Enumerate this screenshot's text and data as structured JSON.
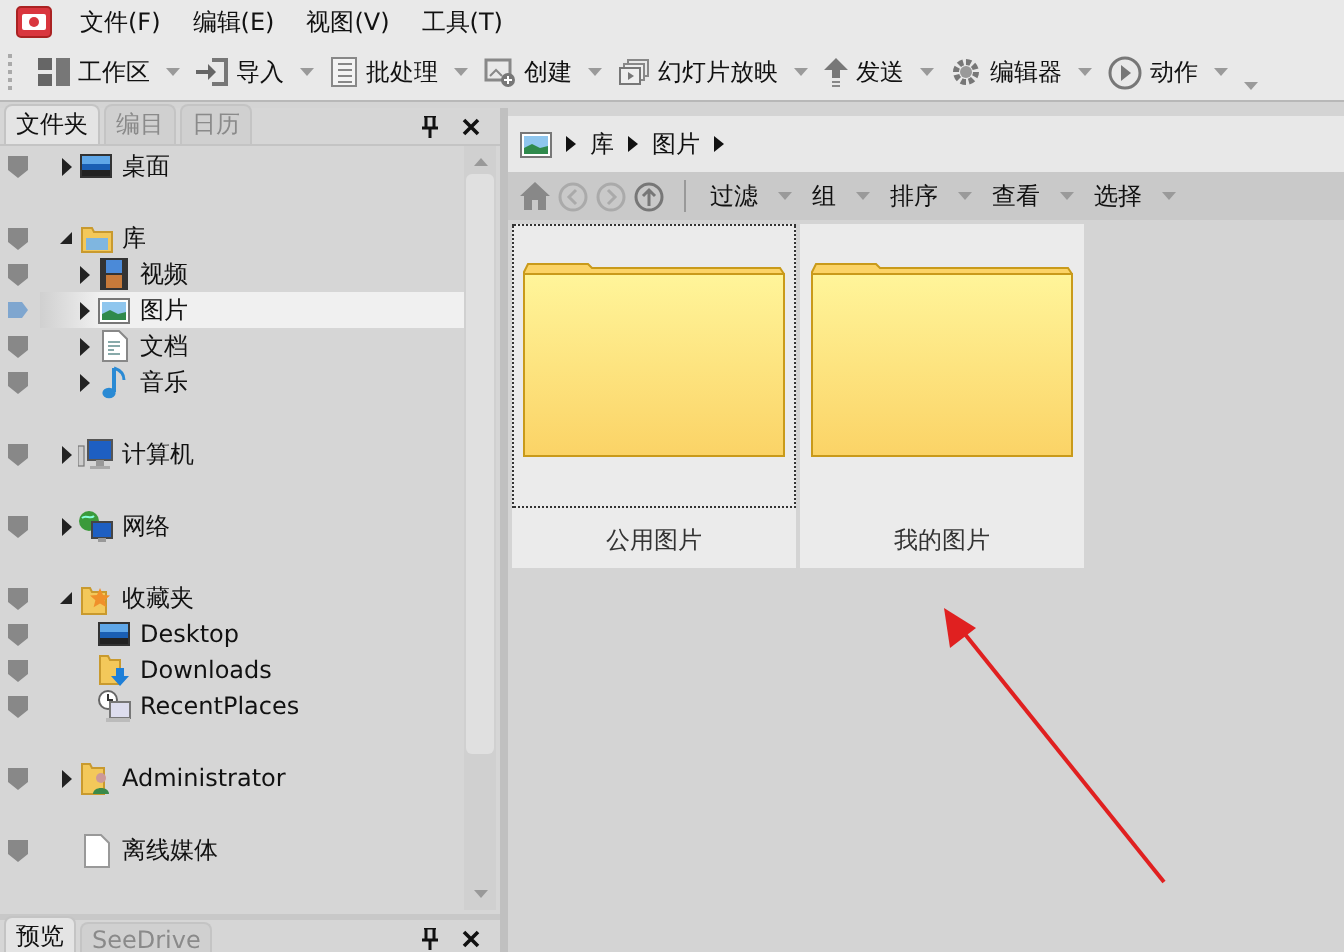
{
  "menu": [
    "文件(F)",
    "编辑(E)",
    "视图(V)",
    "工具(T)"
  ],
  "toolbar": [
    {
      "kind": "workspace",
      "label": "工作区"
    },
    {
      "kind": "import",
      "label": "导入"
    },
    {
      "kind": "batch",
      "label": "批处理"
    },
    {
      "kind": "create",
      "label": "创建"
    },
    {
      "kind": "slideshow",
      "label": "幻灯片放映"
    },
    {
      "kind": "send",
      "label": "发送"
    },
    {
      "kind": "editor",
      "label": "编辑器"
    },
    {
      "kind": "action",
      "label": "动作"
    }
  ],
  "left_tabs": [
    {
      "label": "文件夹",
      "selected": true
    },
    {
      "label": "编目",
      "selected": false
    },
    {
      "label": "日历",
      "selected": false
    }
  ],
  "tree": [
    {
      "kind": "desktop",
      "label": "桌面",
      "expanded": false,
      "selected": false
    },
    {
      "kind": "library",
      "label": "库",
      "expanded": true,
      "selected": false,
      "children": [
        {
          "kind": "video",
          "label": "视频",
          "expanded": false,
          "selected": false
        },
        {
          "kind": "picture",
          "label": "图片",
          "expanded": false,
          "selected": true
        },
        {
          "kind": "document",
          "label": "文档",
          "expanded": false,
          "selected": false
        },
        {
          "kind": "music",
          "label": "音乐",
          "expanded": false,
          "selected": false
        }
      ]
    },
    {
      "kind": "computer",
      "label": "计算机",
      "expanded": false,
      "selected": false
    },
    {
      "kind": "network",
      "label": "网络",
      "expanded": false,
      "selected": false
    },
    {
      "kind": "favorites",
      "label": "收藏夹",
      "expanded": true,
      "selected": false,
      "children": [
        {
          "kind": "desktop",
          "label": "Desktop",
          "selected": false
        },
        {
          "kind": "downloads",
          "label": "Downloads",
          "selected": false
        },
        {
          "kind": "recent",
          "label": "RecentPlaces",
          "selected": false
        }
      ]
    },
    {
      "kind": "user",
      "label": "Administrator",
      "expanded": false,
      "selected": false
    },
    {
      "kind": "file",
      "label": "离线媒体",
      "selected": false
    }
  ],
  "bottom_tabs": [
    {
      "label": "预览",
      "selected": true
    },
    {
      "label": "SeeDrive",
      "selected": false
    }
  ],
  "breadcrumb": [
    "库",
    "图片"
  ],
  "nav_menus": [
    "过滤",
    "组",
    "排序",
    "查看",
    "选择"
  ],
  "folders": [
    {
      "label": "公用图片",
      "focused": true
    },
    {
      "label": "我的图片",
      "focused": false
    }
  ]
}
